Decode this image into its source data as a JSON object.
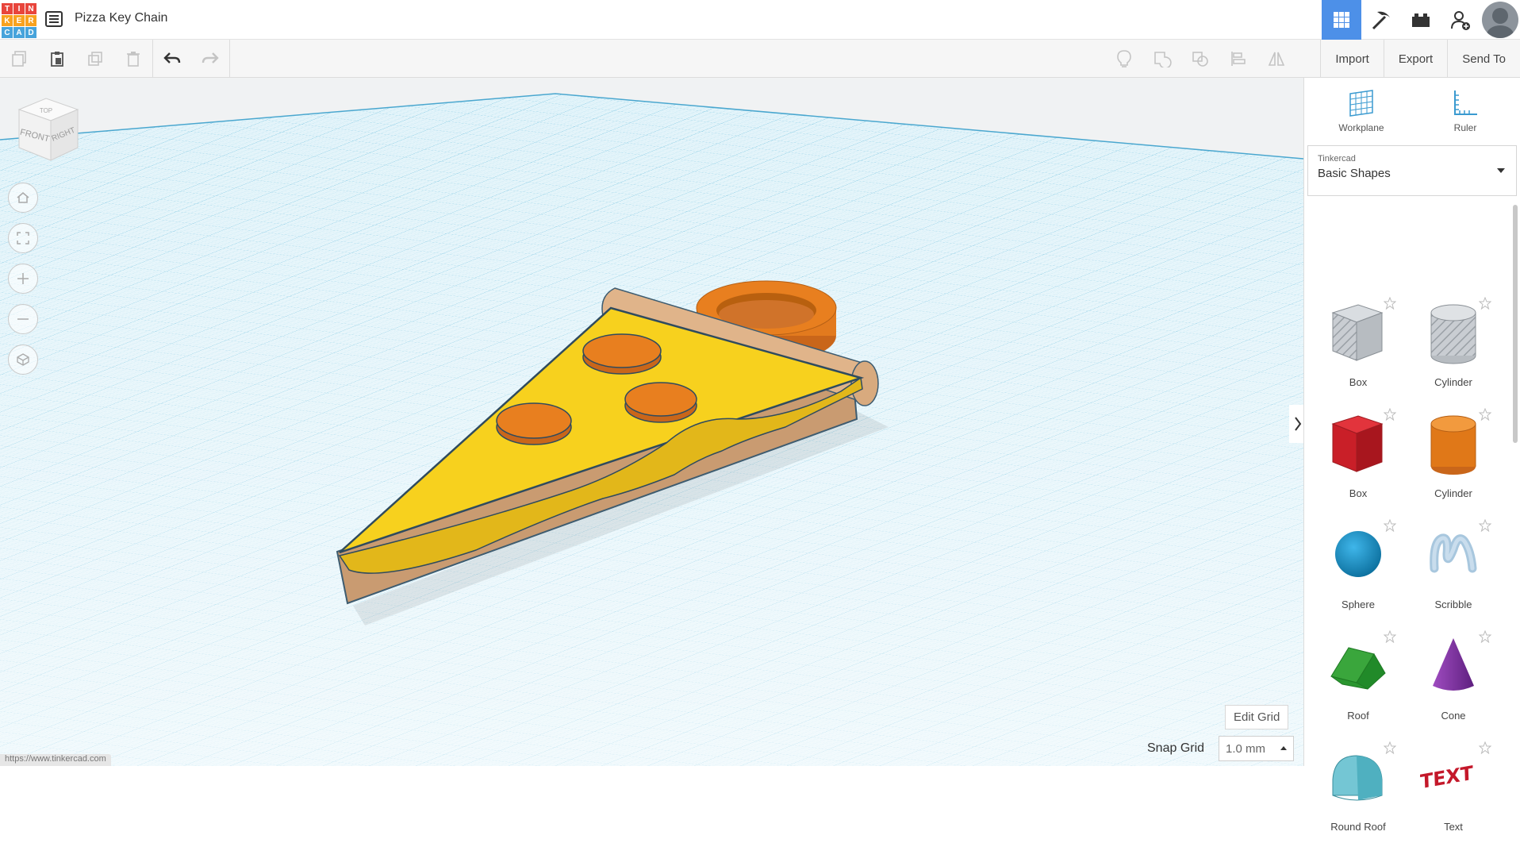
{
  "app": {
    "logo_letters": [
      "T",
      "I",
      "N",
      "K",
      "E",
      "R",
      "C",
      "A",
      "D"
    ],
    "logo_colors": [
      "#e8453c",
      "#e8453c",
      "#e8453c",
      "#f8a21f",
      "#f8a21f",
      "#f8a21f",
      "#47a3db",
      "#47a3db",
      "#47a3db"
    ],
    "document_title": "Pizza Key Chain"
  },
  "toolbar": {
    "import_label": "Import",
    "export_label": "Export",
    "send_to_label": "Send To"
  },
  "viewcube": {
    "top": "TOP",
    "front": "FRONT",
    "right": "RIGHT"
  },
  "canvas": {
    "edit_grid_label": "Edit Grid",
    "snap_grid_label": "Snap Grid",
    "snap_grid_value": "1.0 mm",
    "status_url": "https://www.tinkercad.com"
  },
  "panel": {
    "workplane_label": "Workplane",
    "ruler_label": "Ruler",
    "library_category": "Tinkercad",
    "library_name": "Basic Shapes",
    "shapes": [
      {
        "label": "Box",
        "icon": "box-hole-icon"
      },
      {
        "label": "Cylinder",
        "icon": "cylinder-hole-icon"
      },
      {
        "label": "Box",
        "icon": "box-icon"
      },
      {
        "label": "Cylinder",
        "icon": "cylinder-icon"
      },
      {
        "label": "Sphere",
        "icon": "sphere-icon"
      },
      {
        "label": "Scribble",
        "icon": "scribble-icon"
      },
      {
        "label": "Roof",
        "icon": "roof-icon"
      },
      {
        "label": "Cone",
        "icon": "cone-icon"
      },
      {
        "label": "Round Roof",
        "icon": "round-roof-icon"
      },
      {
        "label": "Text",
        "icon": "text-icon"
      }
    ]
  },
  "colors": {
    "accent": "#4d90e8",
    "crust": "#d4a373",
    "cheese": "#f7d11e",
    "pepperoni": "#e87f1f",
    "grid_line": "#8fd0e6"
  }
}
